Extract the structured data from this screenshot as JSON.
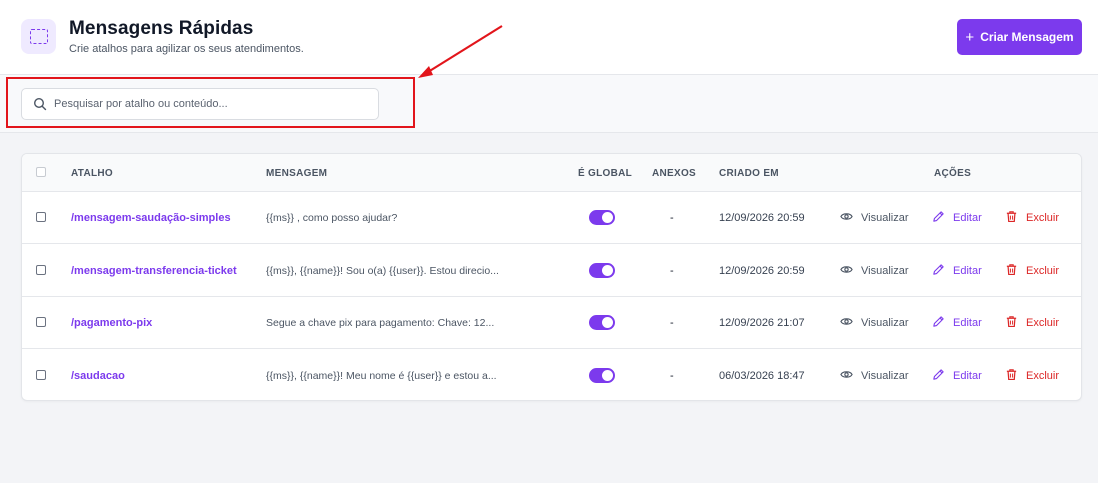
{
  "header": {
    "title": "Mensagens Rápidas",
    "subtitle": "Crie atalhos para agilizar os seus atendimentos.",
    "create_button": "Criar Mensagem"
  },
  "search": {
    "placeholder": "Pesquisar por atalho ou conteúdo..."
  },
  "table": {
    "columns": [
      "ATALHO",
      "MENSAGEM",
      "É GLOBAL",
      "ANEXOS",
      "CRIADO EM",
      "AÇÕES"
    ],
    "actions": {
      "view": "Visualizar",
      "edit": "Editar",
      "delete": "Excluir"
    },
    "rows": [
      {
        "shortcut": "/mensagem-saudação-simples",
        "message": "{{ms}} , como posso ajudar?",
        "global": true,
        "attachments": "-",
        "created": "12/09/2026 20:59"
      },
      {
        "shortcut": "/mensagem-transferencia-ticket",
        "message": "{{ms}}, {{name}}! Sou o(a) {{user}}. Estou direcio...",
        "global": true,
        "attachments": "-",
        "created": "12/09/2026 20:59"
      },
      {
        "shortcut": "/pagamento-pix",
        "message": "Segue a chave pix para pagamento: Chave: 12...",
        "global": true,
        "attachments": "-",
        "created": "12/09/2026 21:07"
      },
      {
        "shortcut": "/saudacao",
        "message": "{{ms}}, {{name}}! Meu nome é {{user}} e estou a...",
        "global": true,
        "attachments": "-",
        "created": "06/03/2026 18:47"
      }
    ]
  },
  "colors": {
    "accent": "#7c3aed",
    "danger": "#dc2626",
    "annotation": "#e2151b"
  }
}
